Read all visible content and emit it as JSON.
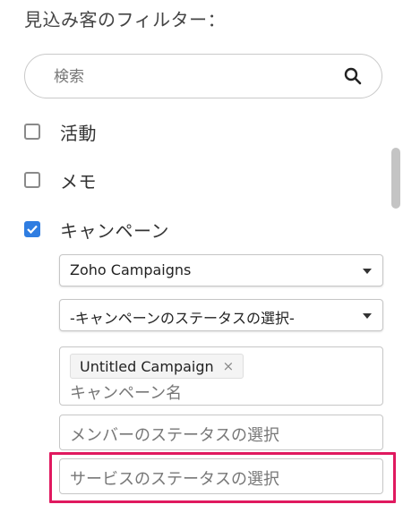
{
  "header": {
    "title": "見込み客のフィルター："
  },
  "search": {
    "placeholder": "検索",
    "icon": "search-icon"
  },
  "filters": [
    {
      "label": "活動",
      "checked": false
    },
    {
      "label": "メモ",
      "checked": false
    },
    {
      "label": "キャンペーン",
      "checked": true
    }
  ],
  "campaign": {
    "source_select": "Zoho Campaigns",
    "status_select": "-キャンペーンのステータスの選択-",
    "selected_tag": "Untitled Campaign",
    "tag_remove": "×",
    "name_placeholder": "キャンペーン名",
    "member_status_placeholder": "メンバーのステータスの選択",
    "service_status_placeholder": "サービスのステータスの選択"
  },
  "colors": {
    "accent": "#2f7de1",
    "highlight": "#e0195f"
  }
}
